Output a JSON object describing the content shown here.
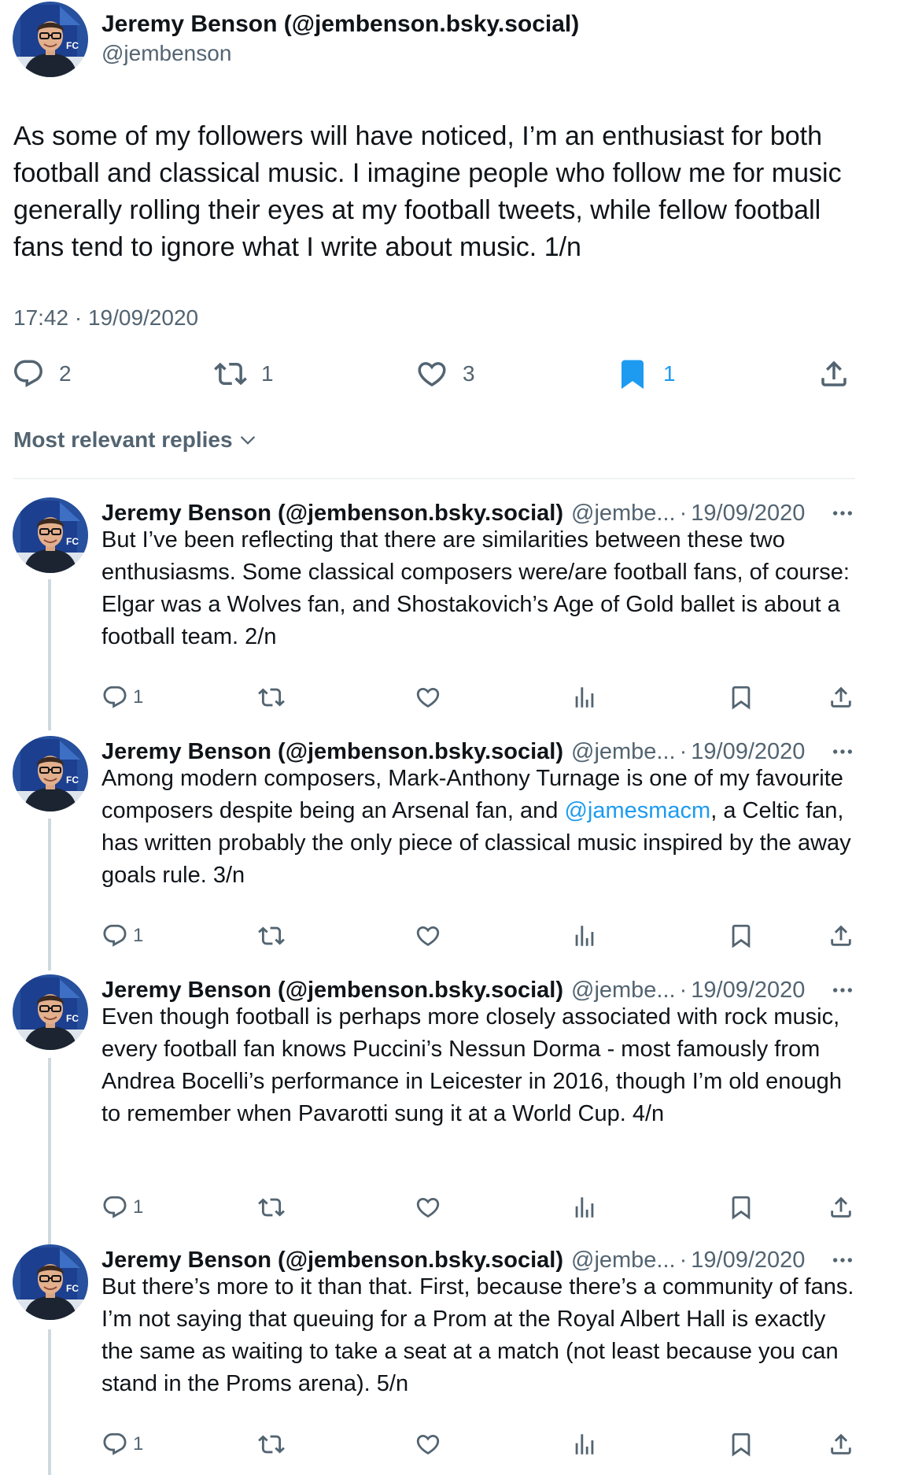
{
  "main": {
    "author_name": "Jeremy Benson (@jembenson.bsky.social)",
    "handle": "@jembenson",
    "text": "As some of my followers will have noticed, I’m an enthusiast for both football and classical music. I imagine people who follow me for music generally rolling their eyes at my football tweets, while fellow football fans tend to ignore what I write about music. 1/n",
    "timestamp": "17:42 · 19/09/2020",
    "counts": {
      "replies": "2",
      "reposts": "1",
      "likes": "3",
      "bookmarks": "1"
    }
  },
  "replies_header": {
    "label": "Most relevant replies"
  },
  "replies": [
    {
      "author_name": "Jeremy Benson (@jembenson.bsky.social)",
      "handle": "@jembe...",
      "separator": "·",
      "date": "19/09/2020",
      "text": "But I’ve been reflecting that there are similarities between these two enthusiasms. Some classical composers were/are football fans, of course: Elgar was a Wolves fan, and Shostakovich’s Age of Gold ballet is about a football team. 2/n",
      "reply_count": "1"
    },
    {
      "author_name": "Jeremy Benson (@jembenson.bsky.social)",
      "handle": "@jembe...",
      "separator": "·",
      "date": "19/09/2020",
      "text_before": "Among modern composers, Mark-Anthony Turnage is one of my favourite composers despite being an Arsenal fan, and ",
      "mention": "@jamesmacm",
      "text_after": ", a Celtic fan, has written probably the only piece of classical music inspired by the away goals rule. 3/n",
      "reply_count": "1"
    },
    {
      "author_name": "Jeremy Benson (@jembenson.bsky.social)",
      "handle": "@jembe...",
      "separator": "·",
      "date": "19/09/2020",
      "text": "Even though football is perhaps more closely associated with rock music, every football fan knows Puccini’s Nessun Dorma - most famously from Andrea Bocelli’s performance in Leicester in 2016, though I’m old enough to remember when Pavarotti sung it at a World Cup. 4/n",
      "reply_count": "1"
    },
    {
      "author_name": "Jeremy Benson (@jembenson.bsky.social)",
      "handle": "@jembe...",
      "separator": "·",
      "date": "19/09/2020",
      "text": "But there’s more to it than that. First, because there’s a community of fans. I’m not saying that queuing for a Prom at the Royal Albert Hall is exactly the same as waiting to take a seat at a match (not least because you can stand in the Proms arena). 5/n",
      "reply_count": "1"
    }
  ],
  "colors": {
    "accent": "#1d9bf0",
    "secondary_text": "#536471",
    "text": "#0f1419",
    "club_blue": "#1c3f8f"
  }
}
